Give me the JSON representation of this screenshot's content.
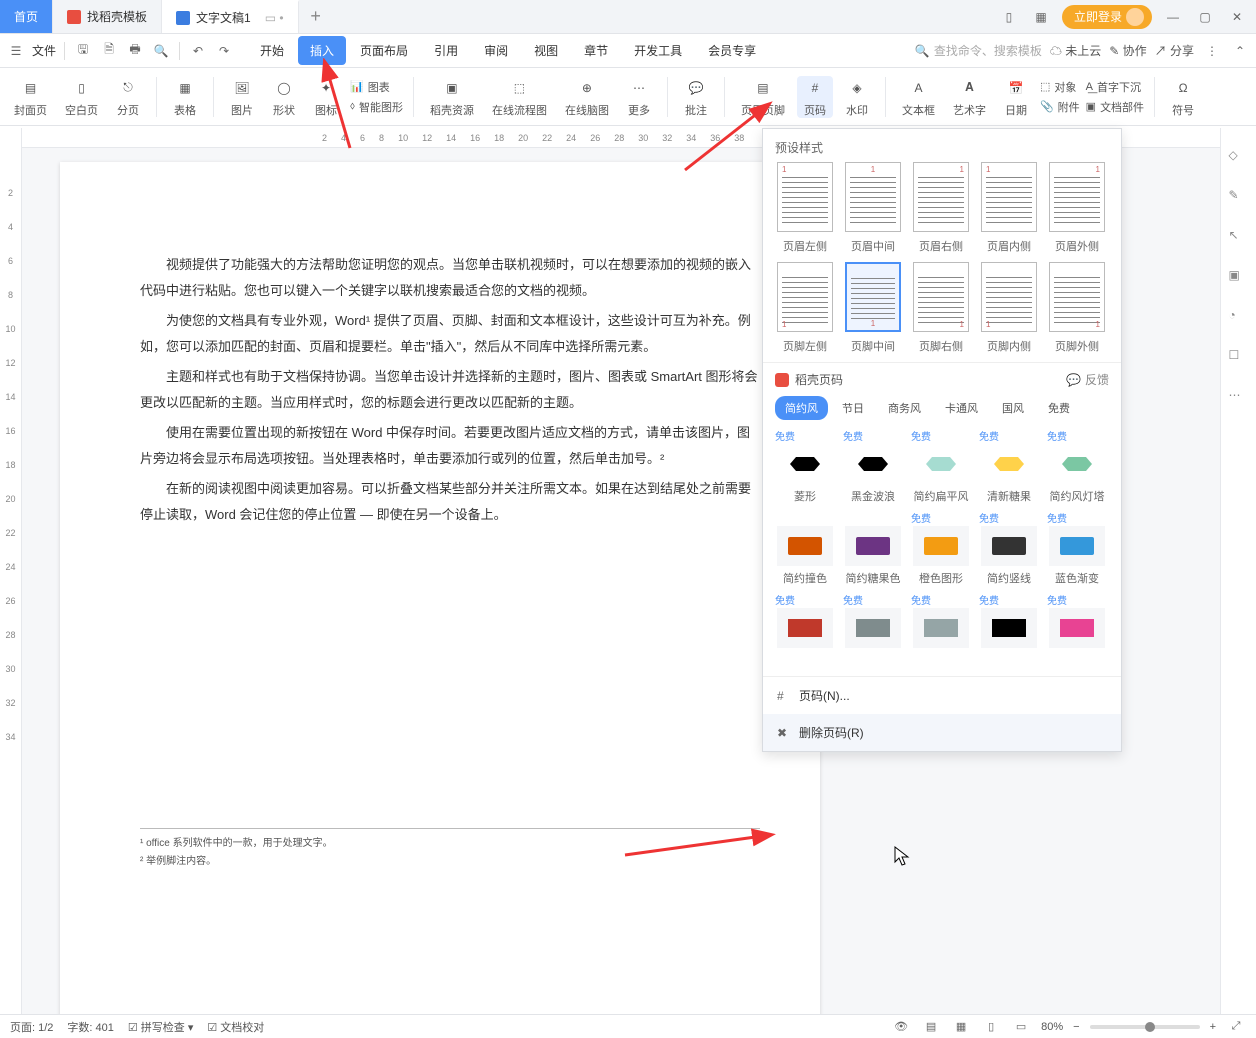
{
  "titlebar": {
    "home": "首页",
    "tab_templates": "找稻壳模板",
    "tab_doc": "文字文稿1",
    "login": "立即登录"
  },
  "menubar": {
    "file": "文件",
    "tabs": [
      "开始",
      "插入",
      "页面布局",
      "引用",
      "审阅",
      "视图",
      "章节",
      "开发工具",
      "会员专享"
    ],
    "search_placeholder": "查找命令、搜索模板",
    "cloud": "未上云",
    "collab": "协作",
    "share": "分享"
  },
  "ribbon": {
    "cover": "封面页",
    "blank": "空白页",
    "break": "分页",
    "table": "表格",
    "picture": "图片",
    "shape": "形状",
    "icons": "图标",
    "chart": "图表",
    "smartart": "智能图形",
    "res": "稻壳资源",
    "flow": "在线流程图",
    "mind": "在线脑图",
    "more": "更多",
    "comment": "批注",
    "headerfooter": "页眉页脚",
    "pagenum": "页码",
    "watermark": "水印",
    "textbox": "文本框",
    "wordart": "艺术字",
    "date": "日期",
    "object": "对象",
    "dropcap": "首字下沉",
    "attach": "附件",
    "docparts": "文档部件",
    "symbol": "符号"
  },
  "document": {
    "paragraphs": [
      "视频提供了功能强大的方法帮助您证明您的观点。当您单击联机视频时，可以在想要添加的视频的嵌入代码中进行粘贴。您也可以键入一个关键字以联机搜索最适合您的文档的视频。",
      "为使您的文档具有专业外观，Word¹ 提供了页眉、页脚、封面和文本框设计，这些设计可互为补充。例如，您可以添加匹配的封面、页眉和提要栏。单击\"插入\"，然后从不同库中选择所需元素。",
      "主题和样式也有助于文档保持协调。当您单击设计并选择新的主题时，图片、图表或 SmartArt 图形将会更改以匹配新的主题。当应用样式时，您的标题会进行更改以匹配新的主题。",
      "使用在需要位置出现的新按钮在 Word 中保存时间。若要更改图片适应文档的方式，请单击该图片，图片旁边将会显示布局选项按钮。当处理表格时，单击要添加行或列的位置，然后单击加号。²",
      "在新的阅读视图中阅读更加容易。可以折叠文档某些部分并关注所需文本。如果在达到结尾处之前需要停止读取，Word 会记住您的停止位置 — 即使在另一个设备上。"
    ],
    "footnotes": [
      "¹ office 系列软件中的一款，用于处理文字。",
      "² 举例脚注内容。"
    ]
  },
  "popup": {
    "preset_title": "预设样式",
    "presets_top": [
      "页眉左侧",
      "页眉中间",
      "页眉右侧",
      "页眉内侧",
      "页眉外侧"
    ],
    "presets_bottom": [
      "页脚左侧",
      "页脚中间",
      "页脚右侧",
      "页脚内侧",
      "页脚外侧"
    ],
    "docer_brand": "稻壳页码",
    "feedback": "反馈",
    "style_tabs": [
      "简约风",
      "节日",
      "商务风",
      "卡通风",
      "国风",
      "免费"
    ],
    "free": "免费",
    "styles_row1": [
      "菱形",
      "黑金波浪",
      "简约扁平风",
      "清新糖果",
      "简约风灯塔"
    ],
    "styles_row2": [
      "简约撞色",
      "简约糖果色",
      "橙色图形",
      "简约竖线",
      "蓝色渐变"
    ],
    "page_number_menu": "页码(N)...",
    "delete_menu": "删除页码(R)"
  },
  "status": {
    "page": "页面: 1/2",
    "words": "字数: 401",
    "spell": "拼写检查",
    "proof": "文档校对",
    "zoom": "80%"
  },
  "ruler_h": [
    "2",
    "4",
    "6",
    "8",
    "10",
    "12",
    "14",
    "16",
    "18",
    "20",
    "22",
    "24",
    "26",
    "28",
    "30",
    "32",
    "34",
    "36",
    "38"
  ],
  "ruler_v": [
    "2",
    "4",
    "6",
    "8",
    "10",
    "12",
    "14",
    "16",
    "18",
    "20",
    "22",
    "24",
    "26",
    "28",
    "30",
    "32",
    "34"
  ]
}
